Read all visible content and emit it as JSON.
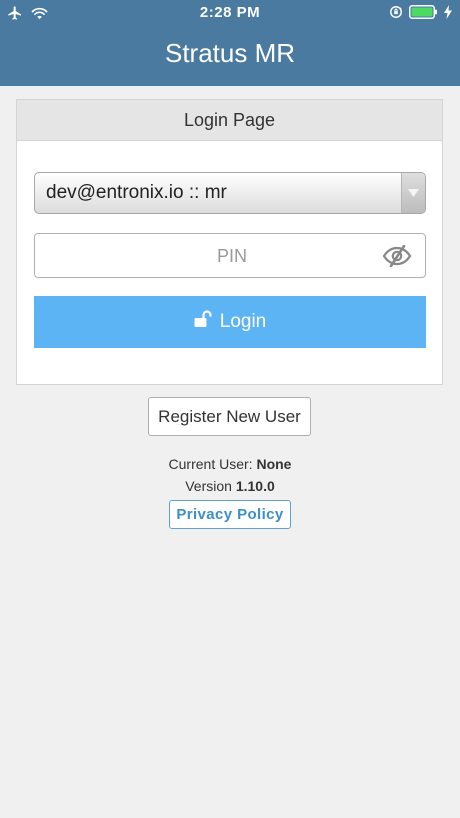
{
  "status_bar": {
    "time": "2:28 PM",
    "left_icons": [
      "airplane-icon",
      "wifi-icon"
    ],
    "right_icons": [
      "orientation-lock-icon",
      "battery-icon",
      "charging-icon"
    ]
  },
  "header": {
    "title": "Stratus MR",
    "background": "#4a7aa0"
  },
  "login_card": {
    "title": "Login Page",
    "account_select": {
      "value": "dev@entronix.io :: mr"
    },
    "pin": {
      "placeholder": "PIN",
      "value": ""
    },
    "login_button": {
      "label": "Login",
      "icon": "unlock-icon",
      "color": "#5cb4f5"
    }
  },
  "register_button": {
    "label": "Register New User"
  },
  "info": {
    "current_user_label": "Current User:",
    "current_user_value": "None",
    "version_label": "Version",
    "version_value": "1.10.0"
  },
  "privacy_link": {
    "label": "Privacy Policy"
  }
}
